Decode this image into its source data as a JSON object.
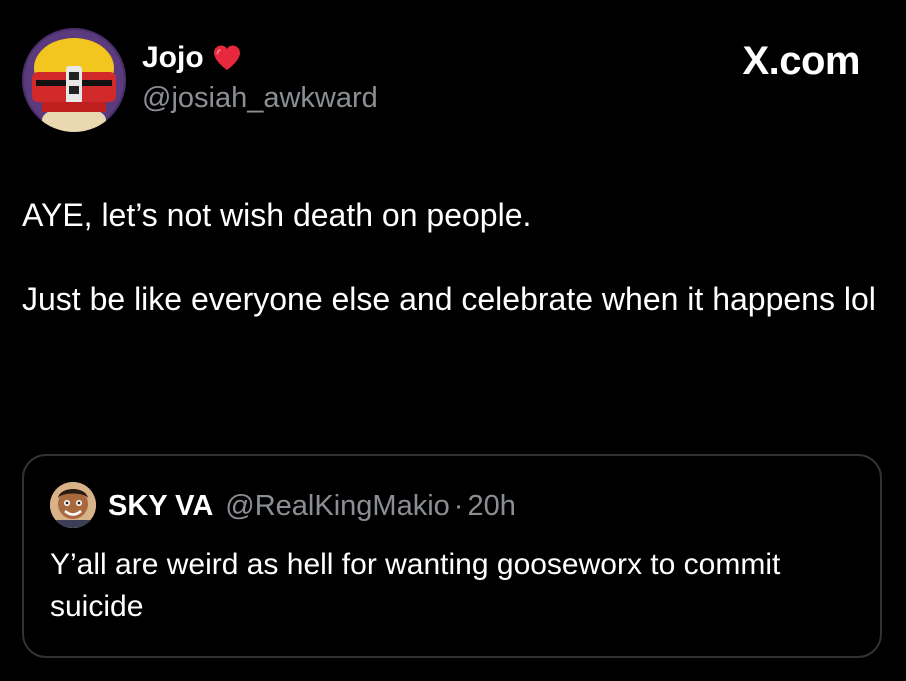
{
  "author": {
    "display_name": "Jojo",
    "handle": "@josiah_awkward",
    "badge_icon": "heart-icon",
    "badge_color": "#e8283c"
  },
  "brand": {
    "label": "X.com"
  },
  "tweet": {
    "paragraphs": [
      "AYE, let’s not wish death on people.",
      "Just be like everyone else and celebrate when it happens lol"
    ]
  },
  "quote": {
    "display_name": "SKY VA",
    "handle": "@RealKingMakio",
    "separator": "·",
    "time": "20h",
    "text": "Y’all are weird as hell for wanting gooseworx to commit suicide"
  },
  "colors": {
    "background": "#000000",
    "text": "#ffffff",
    "secondary_text": "#8b8f94",
    "card_border": "#2f3336"
  }
}
